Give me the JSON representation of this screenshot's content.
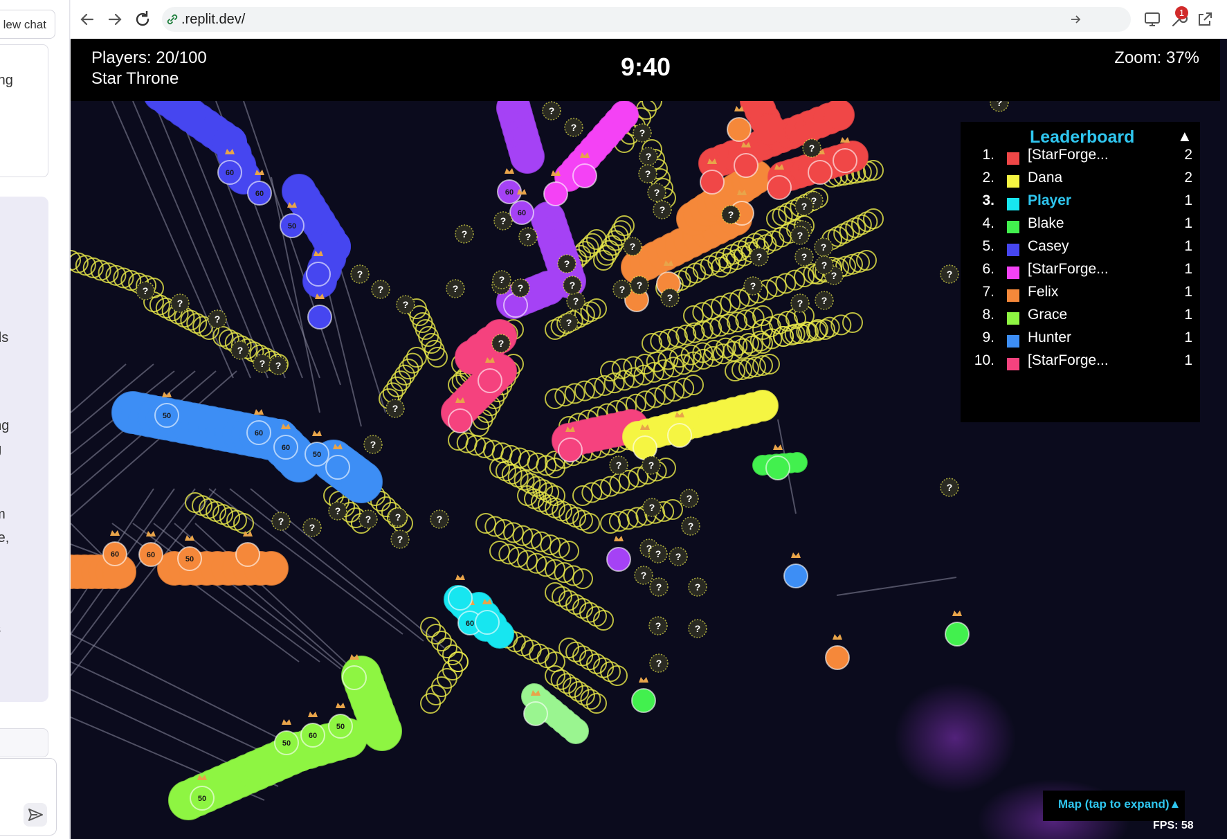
{
  "sidebar": {
    "new_chat_label": "lew chat",
    "fragments": [
      "ding",
      "nds",
      "ring",
      "ng",
      "em",
      "me,",
      "ly",
      "es"
    ]
  },
  "browser": {
    "url": ".replit.dev/",
    "notification_count": "1"
  },
  "hud": {
    "players": "Players: 20/100",
    "game_name": "Star Throne",
    "timer": "9:40",
    "zoom": "Zoom: 37%"
  },
  "leaderboard": {
    "title": "Leaderboard",
    "toggle": "▲",
    "rows": [
      {
        "rank": "1.",
        "name": "[StarForge...",
        "score": "2",
        "color": "#f04747"
      },
      {
        "rank": "2.",
        "name": "Dana",
        "score": "2",
        "color": "#f5f542"
      },
      {
        "rank": "3.",
        "name": "Player",
        "score": "1",
        "color": "#17e6f0",
        "highlight": true
      },
      {
        "rank": "4.",
        "name": "Blake",
        "score": "1",
        "color": "#42f04e"
      },
      {
        "rank": "5.",
        "name": "Casey",
        "score": "1",
        "color": "#4646f0"
      },
      {
        "rank": "6.",
        "name": "[StarForge...",
        "score": "1",
        "color": "#f442f5"
      },
      {
        "rank": "7.",
        "name": "Felix",
        "score": "1",
        "color": "#f5883a"
      },
      {
        "rank": "8.",
        "name": "Grace",
        "score": "1",
        "color": "#8ef542"
      },
      {
        "rank": "9.",
        "name": "Hunter",
        "score": "1",
        "color": "#3d8ef5"
      },
      {
        "rank": "10.",
        "name": "[StarForge...",
        "score": "1",
        "color": "#f5427e"
      }
    ],
    "highlight_color": "#2fc6ef"
  },
  "minimap": {
    "label": "Map (tap to expand)▲"
  },
  "fps": "FPS: 58",
  "planet_labels": {
    "unknown": "?",
    "army_a": "60",
    "army_b": "50"
  },
  "colors": {
    "space": "#0b0b1d",
    "neutral_fill": "#2a2a22",
    "neutral_stroke": "#e8e84a",
    "lane": "#8b8b9e",
    "red": "#f04747",
    "yellow": "#f5f542",
    "cyan": "#17e6f0",
    "green": "#42f04e",
    "blue": "#4646f0",
    "magenta": "#f442f5",
    "orange": "#f5883a",
    "lime": "#8ef542",
    "sky": "#3d8ef5",
    "pink": "#f5427e",
    "purple": "#a542f5",
    "crown": "#e8a44a"
  }
}
